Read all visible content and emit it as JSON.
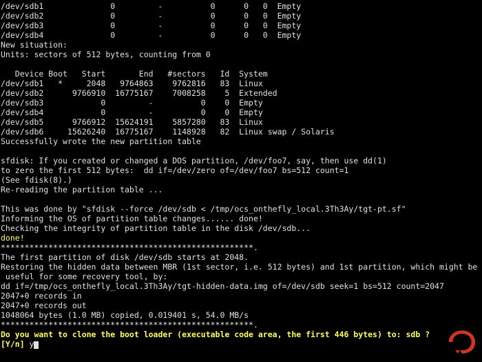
{
  "old_table": [
    {
      "device": "/dev/sdb1",
      "boot": "",
      "start": "0",
      "end": "-",
      "sectors": "0",
      "id": "0",
      "cyls": "0",
      "system": "Empty"
    },
    {
      "device": "/dev/sdb2",
      "boot": "",
      "start": "0",
      "end": "-",
      "sectors": "0",
      "id": "0",
      "cyls": "0",
      "system": "Empty"
    },
    {
      "device": "/dev/sdb3",
      "boot": "",
      "start": "0",
      "end": "-",
      "sectors": "0",
      "id": "0",
      "cyls": "0",
      "system": "Empty"
    },
    {
      "device": "/dev/sdb4",
      "boot": "",
      "start": "0",
      "end": "-",
      "sectors": "0",
      "id": "0",
      "cyls": "0",
      "system": "Empty"
    }
  ],
  "sit_header": "New situation:",
  "units": "Units: sectors of 512 bytes, counting from 0",
  "header": {
    "device": "Device",
    "boot": "Boot",
    "start": "Start",
    "end": "End",
    "sectors": "#sectors",
    "id": "Id",
    "system": "System"
  },
  "new_table": [
    {
      "device": "/dev/sdb1",
      "boot": "*",
      "start": "2048",
      "end": "9764863",
      "sectors": "9762816",
      "id": "83",
      "system": "Linux"
    },
    {
      "device": "/dev/sdb2",
      "boot": "",
      "start": "9766910",
      "end": "16775167",
      "sectors": "7008258",
      "id": "5",
      "system": "Extended"
    },
    {
      "device": "/dev/sdb3",
      "boot": "",
      "start": "0",
      "end": "-",
      "sectors": "0",
      "id": "0",
      "system": "Empty"
    },
    {
      "device": "/dev/sdb4",
      "boot": "",
      "start": "0",
      "end": "-",
      "sectors": "0",
      "id": "0",
      "system": "Empty"
    },
    {
      "device": "/dev/sdb5",
      "boot": "",
      "start": "9766912",
      "end": "15624191",
      "sectors": "5857280",
      "id": "83",
      "system": "Linux"
    },
    {
      "device": "/dev/sdb6",
      "boot": "",
      "start": "15626240",
      "end": "16775167",
      "sectors": "1148928",
      "id": "82",
      "system": "Linux swap / Solaris"
    }
  ],
  "success": "Successfully wrote the new partition table",
  "hint1": "sfdisk: If you created or changed a DOS partition, /dev/foo7, say, then use dd(1)",
  "hint2": "to zero the first 512 bytes:  dd if=/dev/zero of=/dev/foo7 bs=512 count=1",
  "hint3": "(See fdisk(8).)",
  "reread": "Re-reading the partition table ...",
  "done_by": "This was done by \"sfdisk --force /dev/sdb < /tmp/ocs_onthefly_local.3Th3Ay/tgt-pt.sf\"",
  "inform": "Informing the OS of partition table changes...... done!",
  "checking": "Checking the integrity of partition table in the disk /dev/sdb...",
  "done": "done!",
  "stars": "*****************************************************.",
  "first_part": "The first partition of disk /dev/sdb starts at 2048.",
  "restore1": "Restoring the hidden data between MBR (1st sector, i.e. 512 bytes) and 1st partition, which might be",
  "restore2": " useful for some recovery tool, by:",
  "dd_cmd": "dd if=/tmp/ocs_onthefly_local.3Th3Ay/tgt-hidden-data.img of=/dev/sdb seek=1 bs=512 count=2047",
  "rec_in": "2047+0 records in",
  "rec_out": "2047+0 records out",
  "copied": "1048064 bytes (1.0 MB) copied, 0.019401 s, 54.0 MB/s",
  "prompt": "Do you want to clone the boot loader (executable code area, the first 446 bytes) to: sdb ?",
  "yn": "[Y/n] ",
  "answer": "y"
}
